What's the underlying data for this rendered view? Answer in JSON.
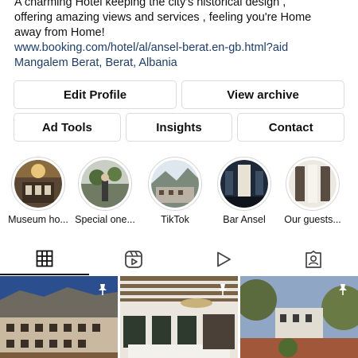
{
  "bio": {
    "line1": "A charming Hotel keeping the city's historical design ,",
    "line2": "offering amazing views and services , feeling you're Home",
    "line3": "away from Home!",
    "link": "www.booking.com/hotel/al/ansel-berat.en-gb.html?aid",
    "location": "Mangalem Berat, Berat, Albania"
  },
  "buttons": {
    "edit_profile": "Edit Profile",
    "view_archive": "View archive",
    "ad_tools": "Ad Tools",
    "insights": "Insights",
    "contact": "Contact"
  },
  "highlights": [
    {
      "label": "Museum ho..."
    },
    {
      "label": "Special one..."
    },
    {
      "label": "TikTok"
    },
    {
      "label": "Bar Ansel"
    },
    {
      "label": "Our guests..."
    }
  ],
  "tabs": [
    {
      "icon": "grid-icon",
      "active": true
    },
    {
      "icon": "reels-icon",
      "active": false
    },
    {
      "icon": "video-play-icon",
      "active": false
    },
    {
      "icon": "tagged-icon",
      "active": false
    }
  ],
  "posts": [
    {
      "pinned": true
    },
    {
      "pinned": true
    },
    {
      "pinned": true
    }
  ]
}
